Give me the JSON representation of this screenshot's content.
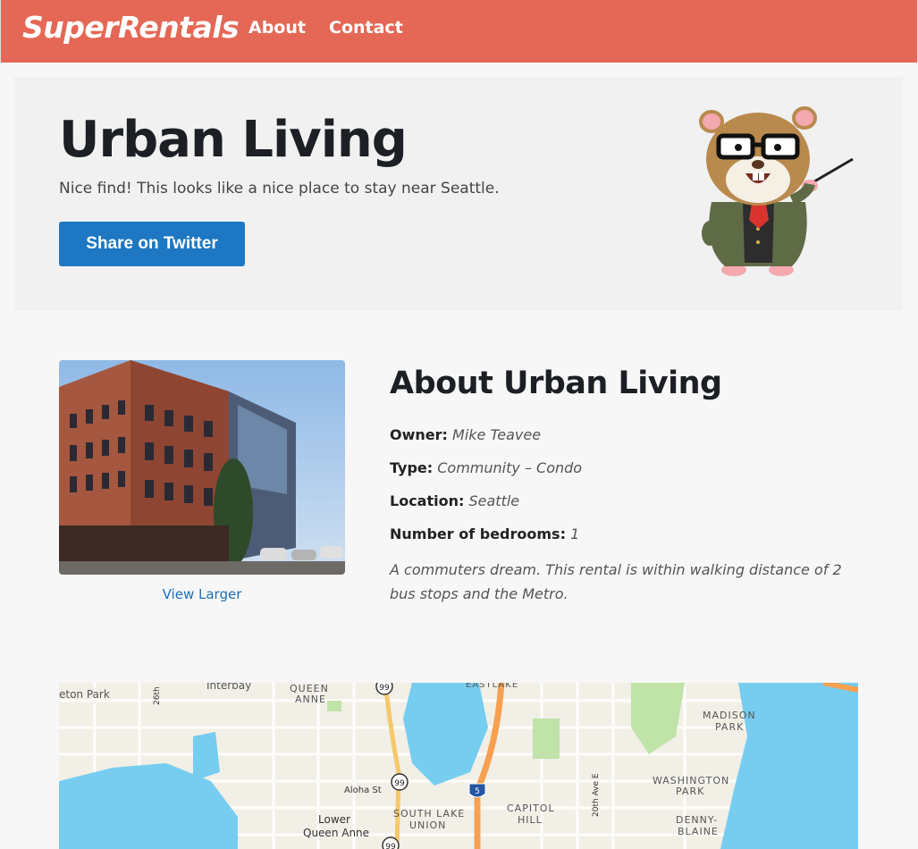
{
  "nav": {
    "brand": "SuperRentals",
    "links": [
      "About",
      "Contact"
    ]
  },
  "jumbo": {
    "title": "Urban Living",
    "subtitle": "Nice find! This looks like a nice place to stay near Seattle.",
    "button": "Share on Twitter"
  },
  "rental": {
    "view_larger": "View Larger",
    "heading": "About Urban Living",
    "owner_label": "Owner:",
    "owner": "Mike Teavee",
    "type_label": "Type:",
    "type": "Community – Condo",
    "location_label": "Location:",
    "location": "Seattle",
    "bedrooms_label": "Number of bedrooms:",
    "bedrooms": "1",
    "description": "A commuters dream. This rental is within walking distance of 2 bus stops and the Metro."
  },
  "map": {
    "labels": [
      "eton Park",
      "Interbay",
      "QUEEN",
      "ANNE",
      "EASTLAKE",
      "MADISON",
      "PARK",
      "Aloha St",
      "WASHINGTON",
      "PARK",
      "SOUTH LAKE",
      "UNION",
      "CAPITOL",
      "HILL",
      "Lower",
      "Queen Anne",
      "DENNY-",
      "BLAINE",
      "20th Ave E",
      "26th"
    ],
    "shields": [
      "99",
      "99",
      "5",
      "99"
    ]
  },
  "colors": {
    "navbar": "#e46855",
    "button": "#1d77c3",
    "link": "#1d6fb8",
    "water": "#76cdf0"
  }
}
